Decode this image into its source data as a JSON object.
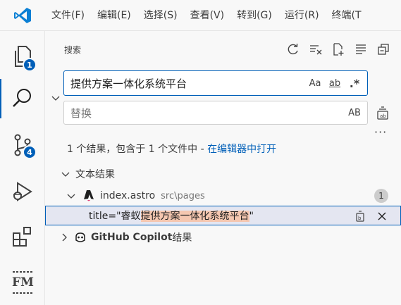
{
  "menu": [
    "文件(F)",
    "编辑(E)",
    "选择(S)",
    "查看(V)",
    "转到(G)",
    "运行(R)",
    "终端(T"
  ],
  "activity": {
    "explorer_badge": "1",
    "scm_badge": "4",
    "fm_label": "FM"
  },
  "sidebar": {
    "title": "搜索",
    "search": {
      "value": "提供方案一体化系统平台",
      "opt_case": "Aa",
      "opt_word": "ab",
      "opt_regex": ".*"
    },
    "replace": {
      "placeholder": "替换",
      "opt_preserve": "AB"
    },
    "summary": {
      "text": "1 个结果，包含于 1 个文件中 - ",
      "link": "在编辑器中打开"
    },
    "text_results_label": "文本结果",
    "file": {
      "name": "index.astro",
      "path": "src\\pages",
      "count": "1"
    },
    "match": {
      "prefix": "title=\"睿蚁",
      "highlight": "提供方案一体化系统平台",
      "suffix": "\""
    },
    "copilot_label": "GitHub Copilot",
    "copilot_suffix": " 结果"
  },
  "colors": {
    "accent": "#005fb8",
    "highlight": "#f5c7b0",
    "astro_icon": "#1f1f1f"
  }
}
